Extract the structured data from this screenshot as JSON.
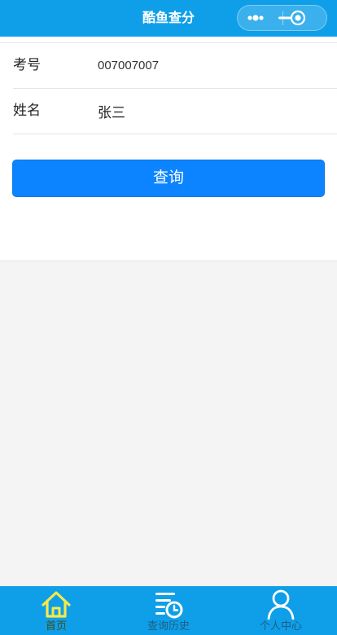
{
  "navbar": {
    "title": "酷鱼查分",
    "more_icon": "more-dots-icon",
    "close_icon": "target-circle-icon",
    "background": "#0f9fe8"
  },
  "form": {
    "fields": [
      {
        "label": "考号",
        "value": "007007007"
      },
      {
        "label": "姓名",
        "value": "张三"
      }
    ],
    "submit_label": "查询",
    "submit_color": "#0d84ff"
  },
  "tabbar": {
    "background": "#0f9fe8",
    "active_color": "#f7e84a",
    "items": [
      {
        "label": "首页",
        "icon": "home-icon",
        "active": true
      },
      {
        "label": "查询历史",
        "icon": "history-list-clock-icon",
        "active": false
      },
      {
        "label": "个人中心",
        "icon": "user-profile-icon",
        "active": false
      }
    ]
  }
}
